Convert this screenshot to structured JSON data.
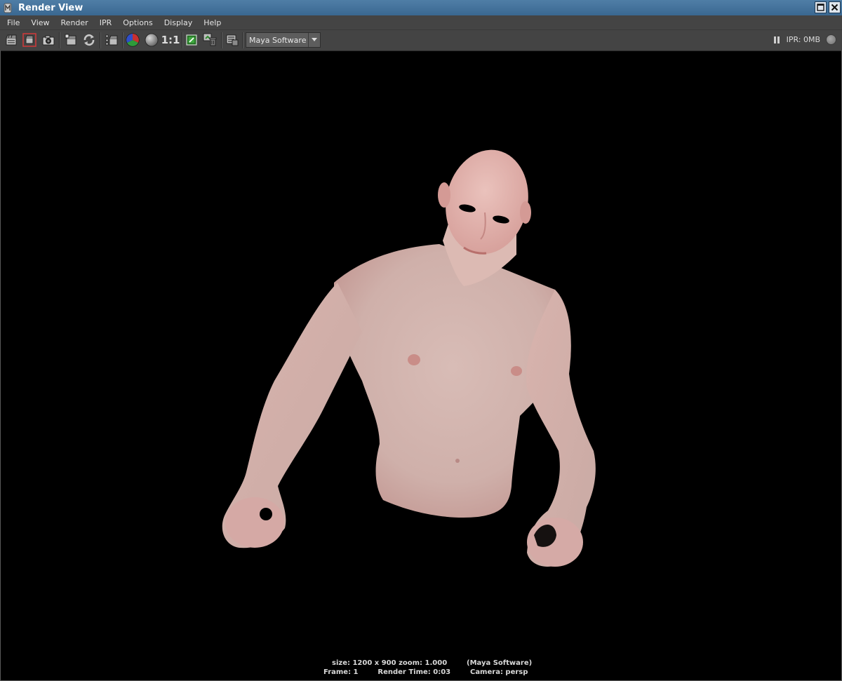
{
  "window": {
    "title": "Render View",
    "title_bar_color": "#3f6e97",
    "window_controls": [
      "maximize-icon",
      "close-icon"
    ]
  },
  "menubar": {
    "items": [
      "File",
      "View",
      "Render",
      "IPR",
      "Options",
      "Display",
      "Help"
    ]
  },
  "toolbar": {
    "icons": [
      "redo-previous-render-icon",
      "render-region-icon",
      "snapshot-icon",
      "redo-previous-ipr-icon",
      "refresh-ipr-icon",
      "ipr-render-region-icon",
      "rgb-channels-icon",
      "alpha-channel-icon",
      "real-size-icon",
      "keep-image-icon",
      "remove-image-icon",
      "render-settings-icon"
    ],
    "real_size_label": "1:1",
    "renderer": "Maya Software",
    "ipr_memory": "IPR: 0MB"
  },
  "viewport": {
    "background": "#000000",
    "status_line_1": "size: 1200 x 900 zoom: 1.000        (Maya Software)",
    "status_line_2": "Frame: 1        Render Time: 0:03        Camera: persp"
  }
}
